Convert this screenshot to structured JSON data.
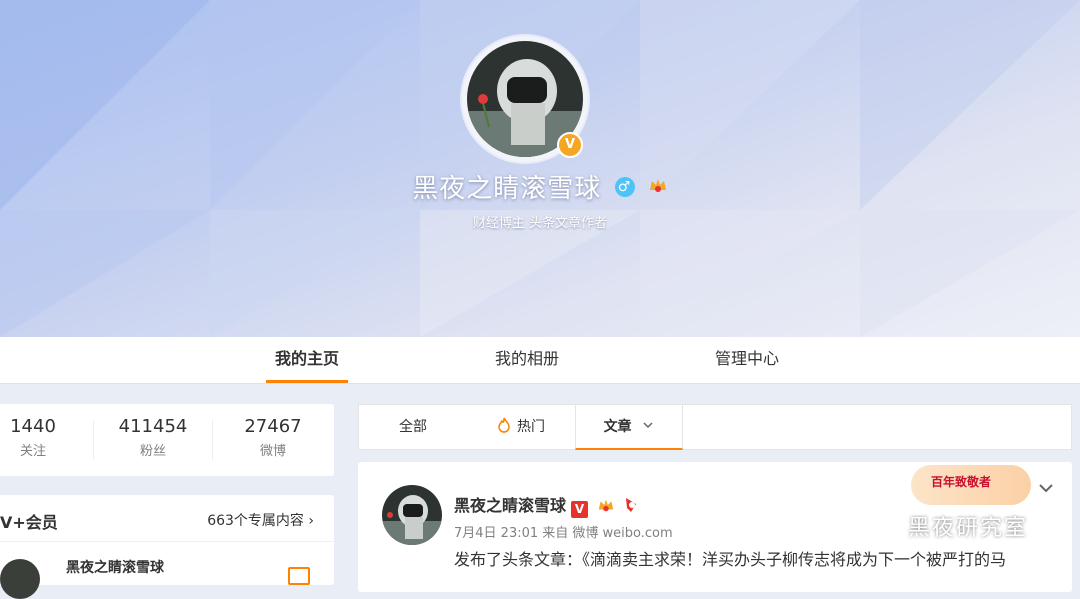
{
  "profile": {
    "name": "黑夜之睛滚雪球",
    "subtitle": "财经博主 头条文章作者",
    "gender_icon": "male-icon",
    "verified_badge": "V"
  },
  "nav": {
    "items": [
      {
        "label": "我的主页",
        "active": true
      },
      {
        "label": "我的相册",
        "active": false
      },
      {
        "label": "管理中心",
        "active": false
      }
    ]
  },
  "stats": [
    {
      "value": "1440",
      "label": "关注"
    },
    {
      "value": "411454",
      "label": "粉丝"
    },
    {
      "value": "27467",
      "label": "微博"
    }
  ],
  "vip": {
    "title": "V+会员",
    "more": "663个专属内容",
    "author": "黑夜之睛滚雪球"
  },
  "feed_tabs": [
    {
      "label": "全部"
    },
    {
      "label": "热门"
    },
    {
      "label": "文章",
      "active": true
    }
  ],
  "post": {
    "author": "黑夜之睛滚雪球",
    "v_badge": "V",
    "time": "7月4日 23:01",
    "source": "来自 微博 weibo.com",
    "text": "发布了头条文章：《滴滴卖主求荣！洋买办头子柳传志将成为下一个被严打的马"
  },
  "promo": {
    "label": "百年致敬者"
  },
  "watermark": "黑夜研究室",
  "colors": {
    "accent": "#ff8200",
    "gold": "#f5a623",
    "vip_red": "#e8332a"
  }
}
